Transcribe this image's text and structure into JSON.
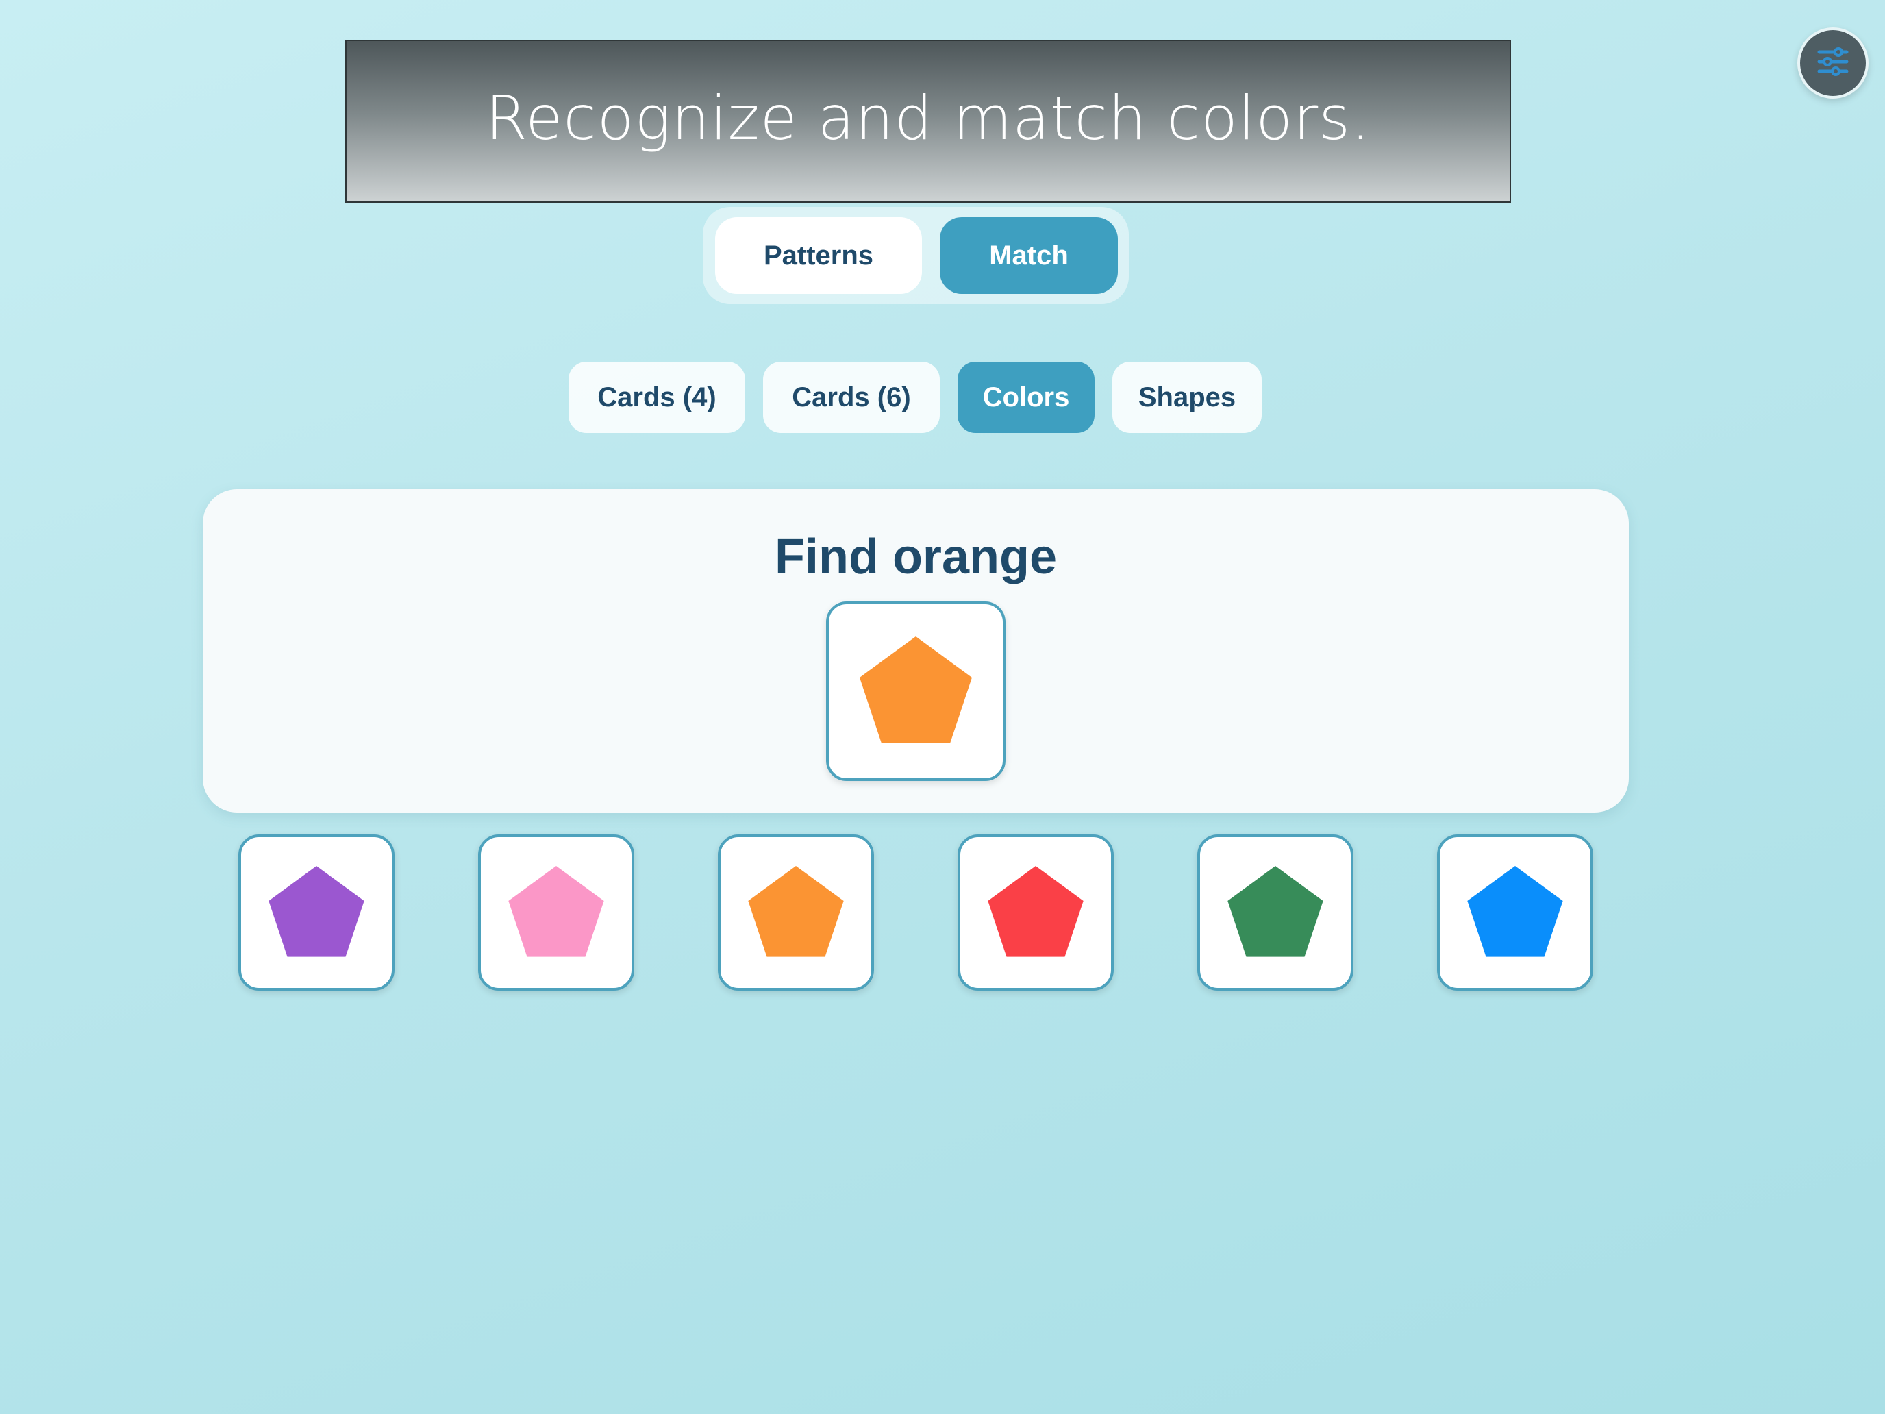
{
  "caption": "Recognize and match colors.",
  "menu_icon": "sliders-icon",
  "mode_tabs": [
    {
      "label": "Patterns",
      "active": false
    },
    {
      "label": "Match",
      "active": true
    }
  ],
  "game_tabs": [
    {
      "label": "Cards (4)",
      "active": false
    },
    {
      "label": "Cards (6)",
      "active": false
    },
    {
      "label": "Colors",
      "active": true
    },
    {
      "label": "Shapes",
      "active": false
    }
  ],
  "prompt": {
    "title": "Find orange",
    "target": {
      "shape": "pentagon",
      "color": "#fb9433"
    }
  },
  "options": [
    {
      "shape": "pentagon",
      "color": "#9b57d0"
    },
    {
      "shape": "pentagon",
      "color": "#fb97c7"
    },
    {
      "shape": "pentagon",
      "color": "#fb9433"
    },
    {
      "shape": "pentagon",
      "color": "#fa4047"
    },
    {
      "shape": "pentagon",
      "color": "#378c59"
    },
    {
      "shape": "pentagon",
      "color": "#0a8efb"
    }
  ],
  "colors": {
    "accent": "#3e9fc0",
    "text": "#1f4a6a",
    "card_border": "#4da2bd"
  }
}
